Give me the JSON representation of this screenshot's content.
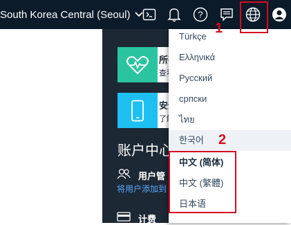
{
  "topbar": {
    "region_label": "South Korea Central (Seoul)",
    "icons": [
      "cloud-shell-icon",
      "bell-icon",
      "help-icon",
      "feedback-icon",
      "globe-icon",
      "user-avatar-icon"
    ]
  },
  "cards": [
    {
      "title": "所有",
      "subtitle": "查看",
      "icon": "heart-pulse-icon",
      "color": "#2bc4a0"
    },
    {
      "title": "安全",
      "subtitle": "了解",
      "icon": "phone-icon",
      "color": "#1ec0f2"
    }
  ],
  "section": {
    "title": "账户中心",
    "user_row_label": "用户管",
    "user_row_link": "将用户添加到",
    "billing_label": "计费"
  },
  "language_menu": {
    "items": [
      "Türkçe",
      "Ελληνικά",
      "Русский",
      "српски",
      "ไทย",
      "한국어",
      "中文 (简体)",
      "中文 (繁體)",
      "日本语"
    ],
    "selected": "中文 (简体)",
    "hovered": "한국어"
  },
  "annotations": {
    "marker_1": "1",
    "marker_2": "2",
    "color": "#d40d1f"
  }
}
